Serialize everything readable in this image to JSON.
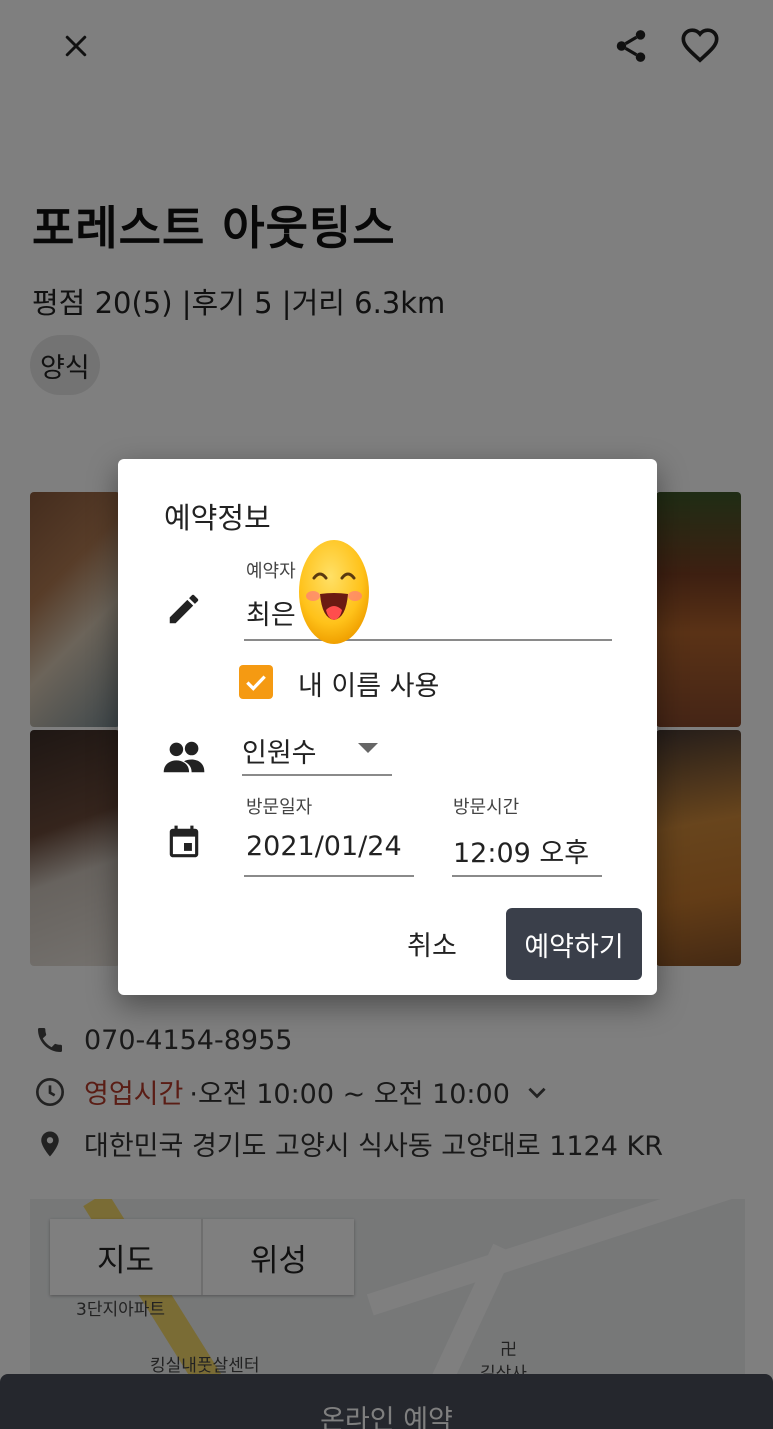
{
  "header": {
    "close_icon": "close-icon",
    "share_icon": "share-icon",
    "favorite_icon": "heart-outline-icon"
  },
  "restaurant": {
    "name": "포레스트 아웃팅스",
    "meta": "평점 20(5) |후기 5 |거리 6.3km",
    "category": "양식"
  },
  "info": {
    "phone": "070-4154-8955",
    "hours_label": "영업시간",
    "hours_value": "·오전 10:00 ~ 오전 10:00",
    "address": "대한민국 경기도 고양시 식사동 고양대로 1124 KR"
  },
  "map": {
    "tab_map": "지도",
    "tab_satellite": "위성",
    "labels": [
      "3단지아파트",
      "킹실내풋살센터",
      "길상사",
      "卍"
    ]
  },
  "bottom_button": "온라인 예약",
  "dialog": {
    "title": "예약정보",
    "name_label": "예약자",
    "name_value": "최은",
    "use_my_name_label": "내 이름 사용",
    "use_my_name_checked": true,
    "party_size_value": "인원수",
    "visit_date_label": "방문일자",
    "visit_date_value": "2021/01/24",
    "visit_time_label": "방문시간",
    "visit_time_value": "12:09 오후",
    "cancel_label": "취소",
    "submit_label": "예약하기"
  },
  "colors": {
    "accent_checkbox": "#f59a12",
    "submit_button": "#3a3f4a",
    "hours_label": "#b53a2a",
    "scrim": "rgba(0,0,0,0.5)"
  }
}
